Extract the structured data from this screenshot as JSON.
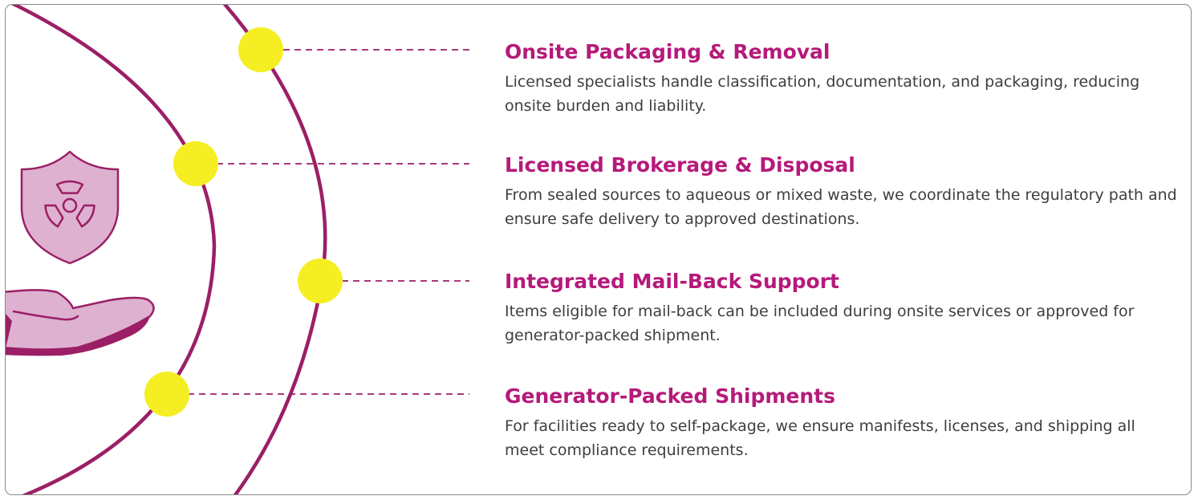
{
  "colors": {
    "accent": "#b51a7a",
    "arc": "#9b1f66",
    "node": "#f5ee22",
    "icon_fill": "#ddb1cf",
    "text": "#3e3e3e"
  },
  "icons": {
    "shield": "radiation-shield-icon",
    "hand": "open-hand-icon"
  },
  "items": [
    {
      "title": "Onsite Packaging & Removal",
      "description": "Licensed specialists handle classification, documentation, and packaging, reducing onsite burden and liability."
    },
    {
      "title": "Licensed Brokerage & Disposal",
      "description": "From sealed sources to aqueous or mixed waste, we coordinate the regulatory path and ensure safe delivery to approved destinations."
    },
    {
      "title": "Integrated Mail-Back Support",
      "description": "Items eligible for mail-back can be included during onsite services or approved for generator-packed shipment."
    },
    {
      "title": "Generator-Packed Shipments",
      "description": "For facilities ready to self-package, we ensure manifests, licenses, and shipping all meet compliance requirements."
    }
  ]
}
